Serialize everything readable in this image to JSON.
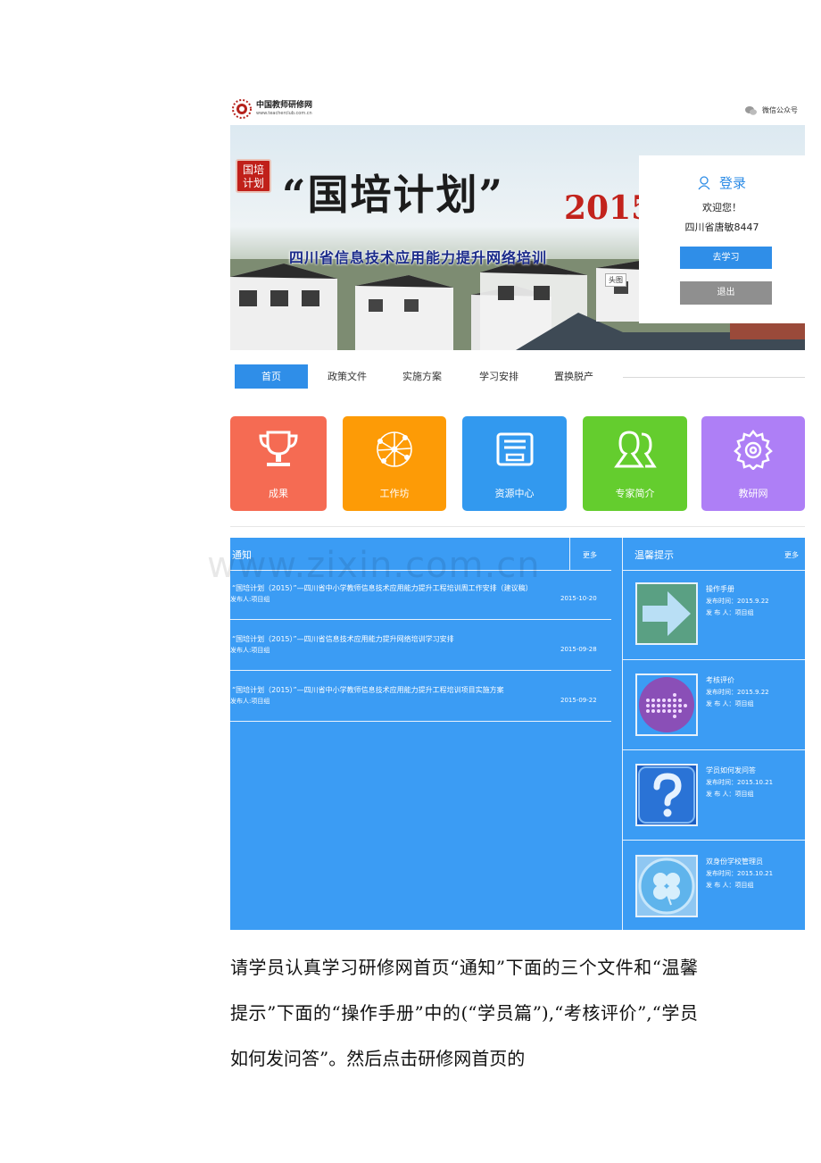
{
  "header": {
    "logo_cn": "中国教师研修网",
    "logo_en": "www.teacherclub.com.cn",
    "wechat_label": "微信公众号"
  },
  "banner": {
    "stamp_line1": "国培",
    "stamp_line2": "计划",
    "title": "“国培计划”",
    "year": "2015",
    "subtitle": "四川省信息技术应用能力提升网络培训",
    "overlay_label": "头图"
  },
  "login": {
    "title": "登录",
    "welcome": "欢迎您！",
    "username": "四川省唐敏8447",
    "study_button": "去学习",
    "exit_button": "退出"
  },
  "nav": {
    "items": [
      {
        "label": "首页",
        "active": true
      },
      {
        "label": "政策文件",
        "active": false
      },
      {
        "label": "实施方案",
        "active": false
      },
      {
        "label": "学习安排",
        "active": false
      },
      {
        "label": "置换脱产",
        "active": false
      }
    ]
  },
  "tiles": [
    {
      "label": "成果",
      "color": "#f56b53",
      "icon": "trophy-icon"
    },
    {
      "label": "工作坊",
      "color": "#fd9b06",
      "icon": "network-icon"
    },
    {
      "label": "资源中心",
      "color": "#3299ef",
      "icon": "box-icon"
    },
    {
      "label": "专家简介",
      "color": "#64cd2e",
      "icon": "people-icon"
    },
    {
      "label": "教研网",
      "color": "#ae7ff6",
      "icon": "gear-icon"
    }
  ],
  "notice": {
    "title": "通知",
    "more": "更多",
    "items": [
      {
        "title": "“国培计划（2015）”—四川省中小学教师信息技术应用能力提升工程培训周工作安排（建议稿）",
        "publisher": "发布人:项目组",
        "date": "2015-10-20"
      },
      {
        "title": "“国培计划（2015）”—四川省信息技术应用能力提升网络培训学习安排",
        "publisher": "发布人:项目组",
        "date": "2015-09-28"
      },
      {
        "title": "“国培计划（2015）”—四川省中小学教师信息技术应用能力提升工程培训项目实施方案",
        "publisher": "发布人:项目组",
        "date": "2015-09-22"
      }
    ]
  },
  "tips": {
    "title": "温馨提示",
    "more": "更多",
    "items": [
      {
        "name": "操作手册",
        "time": "发布时间：2015.9.22",
        "publisher": "发 布 人：项目组",
        "icon": "arrow-right-icon"
      },
      {
        "name": "考核评价",
        "time": "发布时间：2015.9.22",
        "publisher": "发 布 人：项目组",
        "icon": "dotted-arrow-icon"
      },
      {
        "name": "学员如何发问答",
        "time": "发布时间：2015.10.21",
        "publisher": "发 布 人：项目组",
        "icon": "question-icon"
      },
      {
        "name": "双身份学校管理员",
        "time": "发布时间：2015.10.21",
        "publisher": "发 布 人：项目组",
        "icon": "clover-icon"
      }
    ]
  },
  "watermark": "www.zixin.com.cn",
  "paragraph": "请学员认真学习研修网首页“通知”下面的三个文件和“温馨提示”下面的“操作手册”中的(“学员篇”),“考核评价”,“学员如何发问答”。然后点击研修网首页的"
}
